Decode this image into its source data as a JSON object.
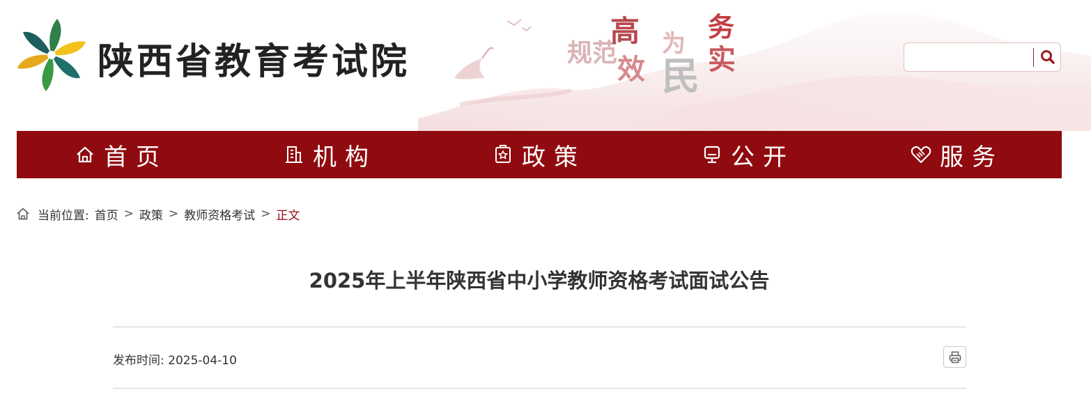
{
  "header": {
    "site_name": "陕西省教育考试院",
    "slogan": {
      "guifan": "规范",
      "gao": "高",
      "xiao": "效",
      "wei": "为",
      "min": "民",
      "wu": "务",
      "shi": "实"
    },
    "search": {
      "placeholder": "",
      "value": "",
      "icon": "search-icon"
    },
    "colors": {
      "brand_red": "#900b0f",
      "accent_red": "#c43d43"
    }
  },
  "nav": {
    "items": [
      {
        "label": "首页",
        "icon": "home-icon"
      },
      {
        "label": "机构",
        "icon": "building-icon"
      },
      {
        "label": "政策",
        "icon": "document-icon"
      },
      {
        "label": "公开",
        "icon": "monitor-icon"
      },
      {
        "label": "服务",
        "icon": "handshake-icon"
      }
    ]
  },
  "breadcrumb": {
    "prefix": "当前位置:",
    "items": [
      "首页",
      "政策",
      "教师资格考试"
    ],
    "separator": ">",
    "current": "正文"
  },
  "article": {
    "title": "2025年上半年陕西省中小学教师资格考试面试公告",
    "publish_label": "发布时间:",
    "publish_date": "2025-04-10",
    "print_icon": "printer-icon"
  }
}
